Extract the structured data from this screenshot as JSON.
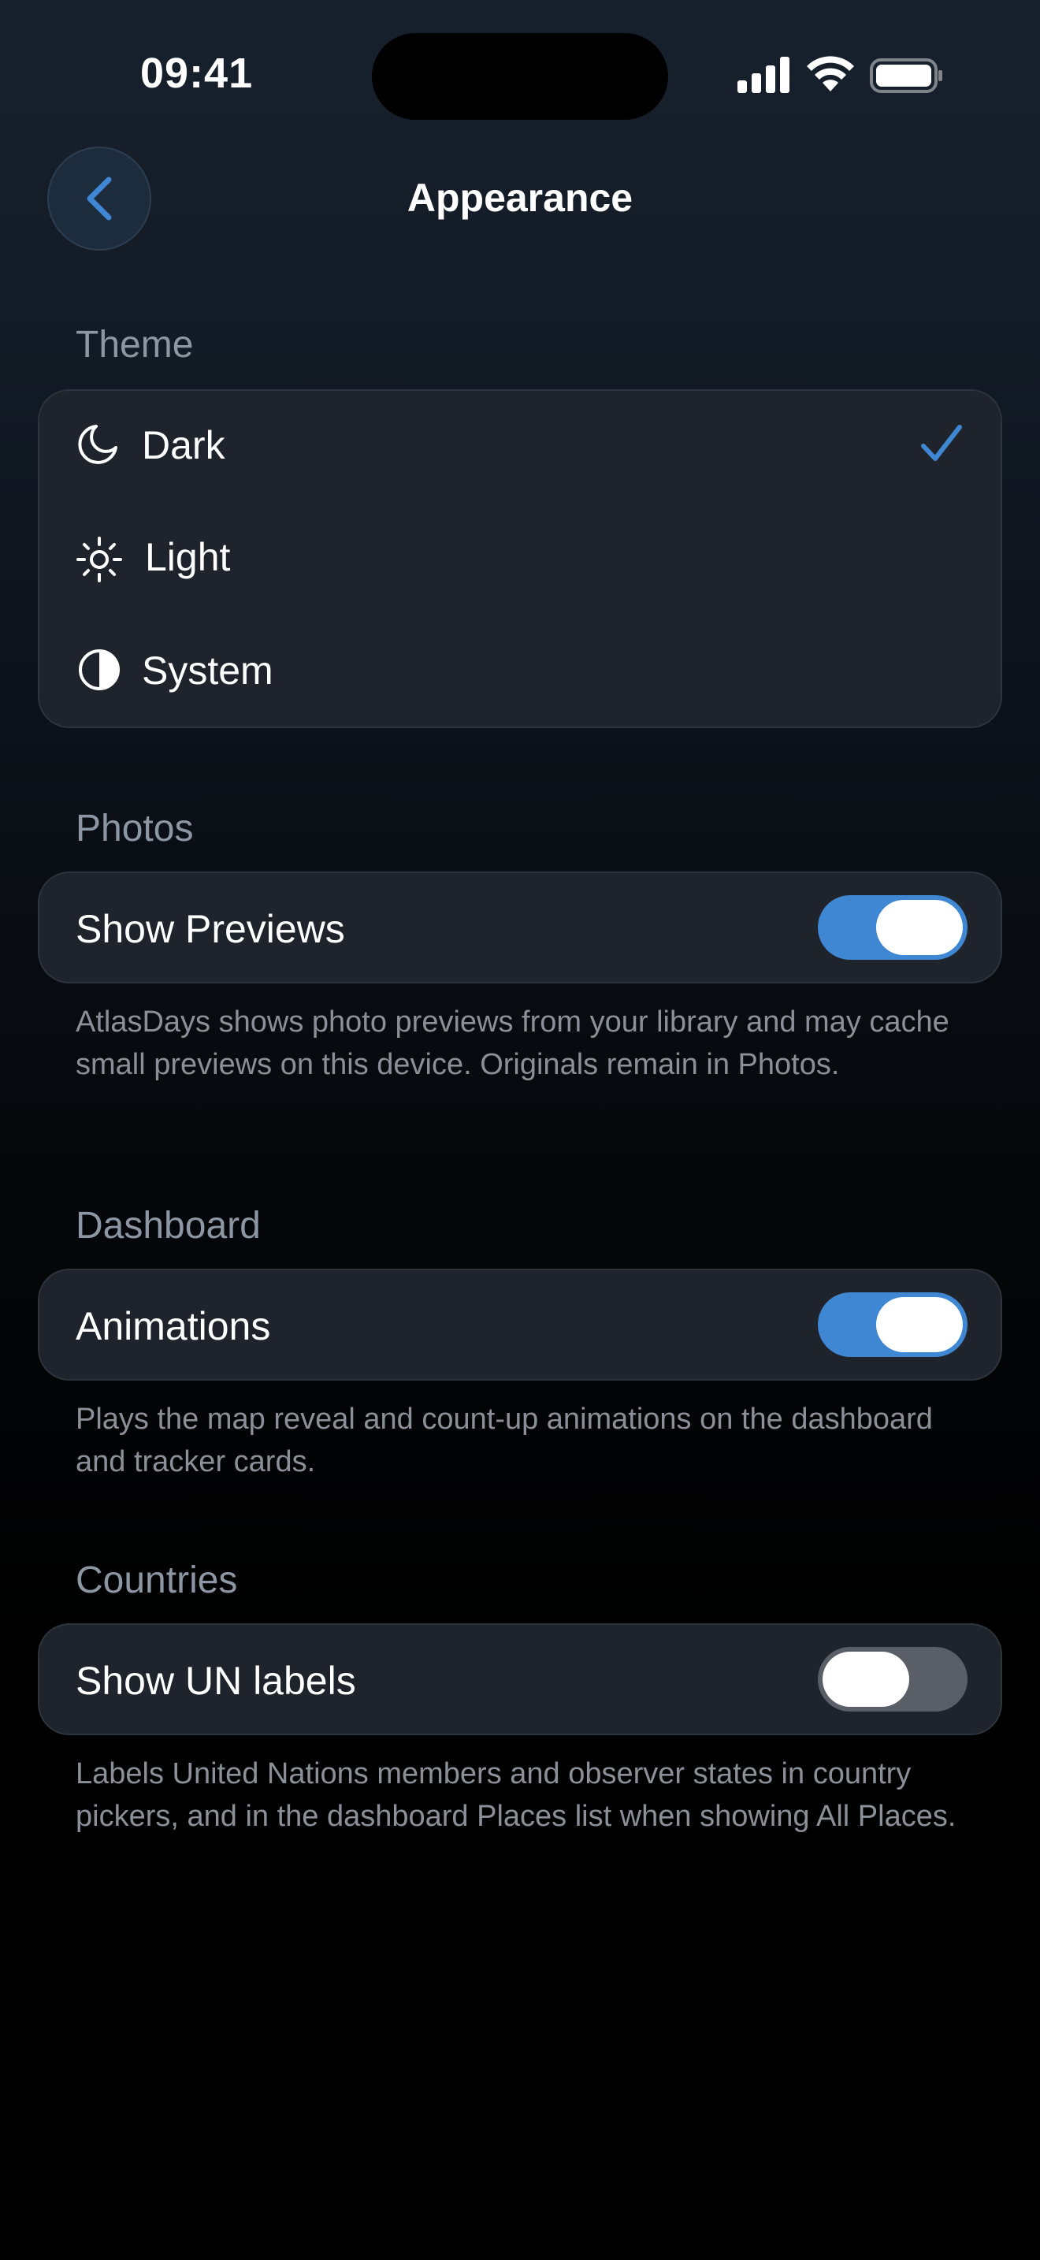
{
  "status_bar": {
    "time": "09:41"
  },
  "nav": {
    "title": "Appearance"
  },
  "theme": {
    "section_label": "Theme",
    "options": [
      {
        "label": "Dark",
        "icon": "moon-icon",
        "selected": true
      },
      {
        "label": "Light",
        "icon": "sun-icon",
        "selected": false
      },
      {
        "label": "System",
        "icon": "half-circle-icon",
        "selected": false
      }
    ]
  },
  "photos": {
    "section_label": "Photos",
    "toggle_label": "Show Previews",
    "toggle_on": true,
    "footnote": "AtlasDays shows photo previews from your library and may cache small previews on this device. Originals remain in Photos."
  },
  "dashboard": {
    "section_label": "Dashboard",
    "toggle_label": "Animations",
    "toggle_on": true,
    "footnote": "Plays the map reveal and count-up animations on the dashboard and tracker cards."
  },
  "countries": {
    "section_label": "Countries",
    "toggle_label": "Show UN labels",
    "toggle_on": false,
    "footnote": "Labels United Nations members and observer states in country pickers, and in the dashboard Places list when showing All Places."
  },
  "colors": {
    "accent": "#3f87d2",
    "card": "#1f242c",
    "section_label": "#8d96a3"
  }
}
